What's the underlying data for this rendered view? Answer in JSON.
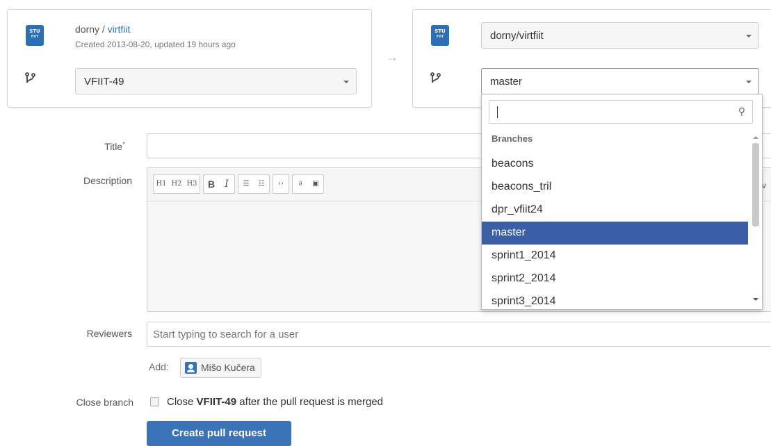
{
  "source": {
    "logo": {
      "line1": "STU",
      "line2": "FIIT"
    },
    "owner": "dorny / ",
    "repo": "virtfiit",
    "meta": "Created 2013-08-20, updated 19 hours ago",
    "branch": "VFIIT-49"
  },
  "target": {
    "logo": {
      "line1": "STU",
      "line2": "FIIT"
    },
    "repo": "dorny/virtfiit",
    "branch": "master"
  },
  "dropdown": {
    "search_value": "",
    "header": "Branches",
    "items": [
      "beacons",
      "beacons_tril",
      "dpr_vfiit24",
      "master",
      "sprint1_2014",
      "sprint2_2014",
      "sprint3_2014"
    ],
    "selected": "master"
  },
  "form": {
    "title_label": "Title",
    "title_required": "*",
    "title_value": "",
    "description_label": "Description",
    "toolbar": {
      "h1": "H1",
      "h2": "H2",
      "h3": "H3",
      "bold": "B",
      "italic": "I",
      "more": "v"
    },
    "reviewers_label": "Reviewers",
    "reviewers_placeholder": "Start typing to search for a user",
    "add_label": "Add:",
    "suggested_reviewer": "Mišo Kučera",
    "close_branch_label": "Close branch",
    "close_text_before": "Close ",
    "close_text_branch": "VFIIT-49",
    "close_text_after": " after the pull request is merged",
    "submit_label": "Create pull request"
  }
}
